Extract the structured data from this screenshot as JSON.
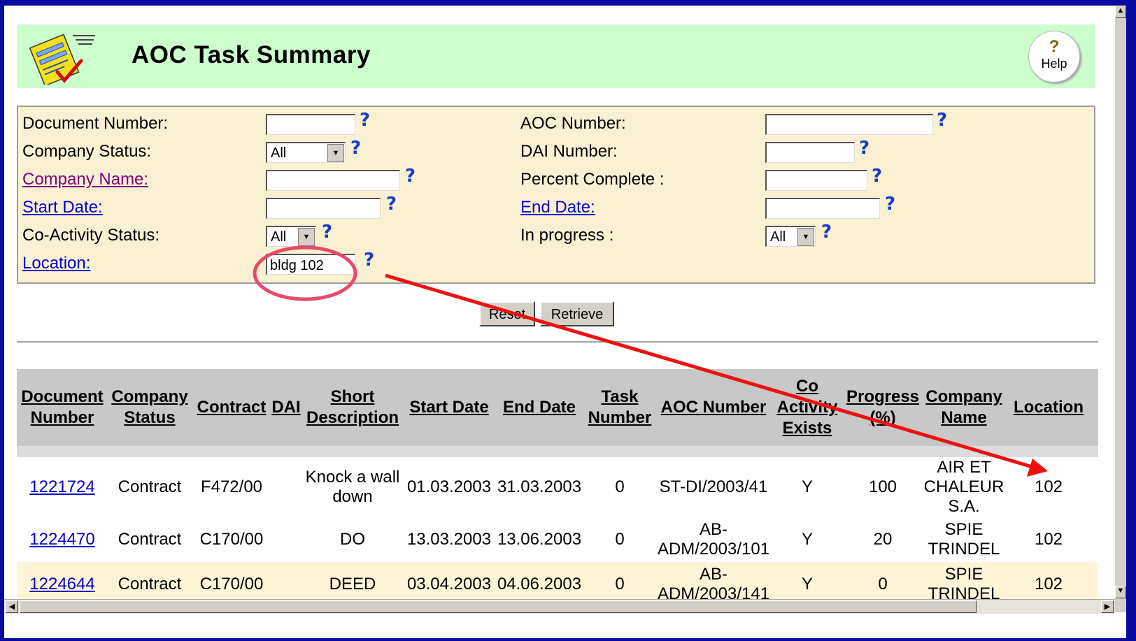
{
  "header": {
    "title": "AOC Task Summary",
    "help_label": "Help",
    "help_symbol": "?"
  },
  "filters": {
    "document_number": {
      "label": "Document Number:",
      "value": ""
    },
    "company_status": {
      "label": "Company Status:",
      "value": "All"
    },
    "company_name": {
      "label": "Company Name:",
      "value": ""
    },
    "start_date": {
      "label": "Start Date:",
      "value": ""
    },
    "co_activity_status": {
      "label": "Co-Activity Status:",
      "value": "All"
    },
    "location": {
      "label": "Location:",
      "value": "bldg 102"
    },
    "aoc_number": {
      "label": "AOC Number:",
      "value": ""
    },
    "dai_number": {
      "label": "DAI Number:",
      "value": ""
    },
    "percent_complete": {
      "label": "Percent Complete :",
      "value": ""
    },
    "end_date": {
      "label": "End Date:",
      "value": ""
    },
    "in_progress": {
      "label": "In progress :",
      "value": "All"
    },
    "help_mark": "?"
  },
  "buttons": {
    "reset": "Reset",
    "retrieve": "Retrieve"
  },
  "table": {
    "columns": [
      "Document Number",
      "Company Status",
      "Contract",
      "DAI",
      "Short Description",
      "Start Date",
      "End Date",
      "Task Number",
      "AOC Number",
      "Co Activity Exists",
      "Progress (%)",
      "Company Name",
      "Location"
    ],
    "rows": [
      [
        "1221724",
        "Contract",
        "F472/00",
        "",
        "Knock a wall down",
        "01.03.2003",
        "31.03.2003",
        "0",
        "ST-DI/2003/41",
        "Y",
        "100",
        "AIR ET CHALEUR S.A.",
        "102"
      ],
      [
        "1224470",
        "Contract",
        "C170/00",
        "",
        "DO",
        "13.03.2003",
        "13.06.2003",
        "0",
        "AB-ADM/2003/101",
        "Y",
        "20",
        "SPIE TRINDEL",
        "102"
      ],
      [
        "1224644",
        "Contract",
        "C170/00",
        "",
        "DEED",
        "03.04.2003",
        "04.06.2003",
        "0",
        "AB-ADM/2003/141",
        "Y",
        "0",
        "SPIE TRINDEL",
        "102"
      ]
    ]
  },
  "colors": {
    "header_bg": "#ccffcc",
    "filter_bg": "#faf0d2",
    "table_header_bg": "#c8c8c8",
    "alt_row_bg": "#fff5d6",
    "annotation_red": "#ee1111",
    "link": "#0000cc"
  }
}
